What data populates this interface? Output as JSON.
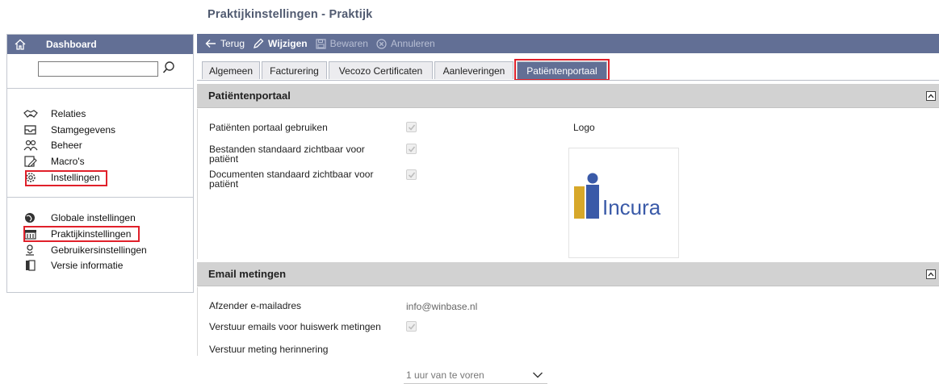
{
  "page": {
    "title": "Praktijkinstellingen - Praktijk"
  },
  "sidebar": {
    "header": "Dashboard",
    "search": {
      "value": "",
      "placeholder": ""
    },
    "group1": [
      {
        "label": "Relaties",
        "icon": "handshake-icon"
      },
      {
        "label": "Stamgegevens",
        "icon": "inbox-icon"
      },
      {
        "label": "Beheer",
        "icon": "users-icon"
      },
      {
        "label": "Macro's",
        "icon": "edit-document-icon"
      },
      {
        "label": "Instellingen",
        "icon": "gear-icon"
      }
    ],
    "group2": [
      {
        "label": "Globale instellingen",
        "icon": "globe-icon"
      },
      {
        "label": "Praktijkinstellingen",
        "icon": "building-icon"
      },
      {
        "label": "Gebruikersinstellingen",
        "icon": "user-badge-icon"
      },
      {
        "label": "Versie informatie",
        "icon": "book-icon"
      }
    ]
  },
  "toolbar": {
    "back_label": "Terug",
    "edit_label": "Wijzigen",
    "save_label": "Bewaren",
    "cancel_label": "Annuleren"
  },
  "tabs": [
    {
      "label": "Algemeen"
    },
    {
      "label": "Facturering"
    },
    {
      "label": "Vecozo Certificaten"
    },
    {
      "label": "Aanleveringen"
    },
    {
      "label": "Patiëntenportaal",
      "active": true
    }
  ],
  "portal": {
    "title": "Patiëntenportaal",
    "rows": [
      {
        "label": "Patiënten portaal gebruiken",
        "checked": true
      },
      {
        "label1": "Bestanden standaard zichtbaar voor",
        "label2": "patiënt",
        "checked": true
      },
      {
        "label1": "Documenten standaard zichtbaar voor",
        "label2": "patiënt",
        "checked": true
      }
    ],
    "logo_label": "Logo",
    "logo_text": "Incura"
  },
  "email": {
    "title": "Email metingen",
    "sender_label": "Afzender e-mailadres",
    "sender_value": "info@winbase.nl",
    "send_label": "Verstuur emails voor huiswerk metingen",
    "send_checked": true,
    "reminder_label": "Verstuur meting herinnering",
    "reminder_value": "1 uur van te voren"
  },
  "colors": {
    "accent": "#626f95",
    "highlight": "#e0202a",
    "section_header": "#d2d2d2",
    "logo_blue": "#3a5aa8",
    "logo_gold": "#d7a82a"
  }
}
